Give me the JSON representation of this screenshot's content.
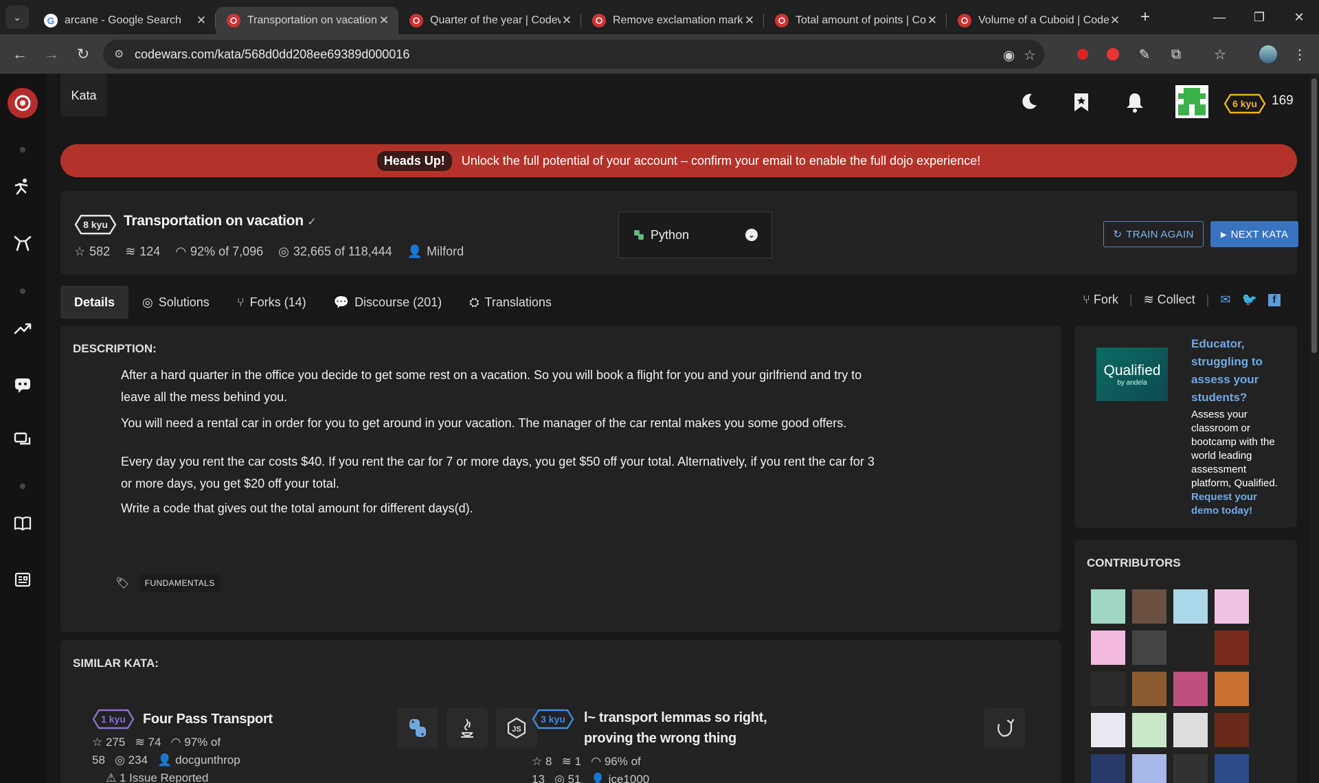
{
  "browser": {
    "tabs": [
      {
        "title": "arcane - Google Search",
        "fav": "google"
      },
      {
        "title": "Transportation on vacation",
        "fav": "codewars",
        "active": true
      },
      {
        "title": "Quarter of the year | Codew",
        "fav": "codewars"
      },
      {
        "title": "Remove exclamation marks",
        "fav": "codewars"
      },
      {
        "title": "Total amount of points | Co",
        "fav": "codewars"
      },
      {
        "title": "Volume of a Cuboid | Code",
        "fav": "codewars"
      }
    ],
    "url": "codewars.com/kata/568d0dd208ee69389d000016"
  },
  "header": {
    "section": "Kata",
    "rank": "6 kyu",
    "honor": "169"
  },
  "banner": {
    "badge": "Heads Up!",
    "text": "Unlock the full potential of your account – confirm your email to enable the full dojo experience!"
  },
  "kata": {
    "rank": "8 kyu",
    "title": "Transportation on vacation",
    "check": "✓",
    "stars": "582",
    "collections": "124",
    "satisfaction": "92% of 7,096",
    "completed": "32,665 of 118,444",
    "author": "Milford",
    "language": "Python",
    "train_again": "TRAIN AGAIN",
    "next_kata": "NEXT KATA"
  },
  "tabs": [
    {
      "label": "Details",
      "icon": "none"
    },
    {
      "label": "Solutions",
      "icon": "target-icon"
    },
    {
      "label": "Forks (14)",
      "icon": "fork-icon"
    },
    {
      "label": "Discourse (201)",
      "icon": "comments-icon"
    },
    {
      "label": "Translations",
      "icon": "sitemap-icon"
    }
  ],
  "tools": {
    "fork": "Fork",
    "collect": "Collect"
  },
  "description": {
    "heading": "DESCRIPTION:",
    "p1": "After a hard quarter in the office you decide to get some rest on a vacation. So you will book a flight for you and your girlfriend and try to leave all the mess behind you.",
    "p2": "You will need a rental car in order for you to get around in your vacation. The manager of the car rental makes you some good offers.",
    "p3": "Every day you rent the car costs $40. If you rent the car for 7 or more days, you get $50 off your total. Alternatively, if you rent the car for 3 or more days, you get $20 off your total.",
    "p4": "Write a code that gives out the total amount for different days(d).",
    "tag": "FUNDAMENTALS"
  },
  "ad": {
    "logo": "Qualified",
    "logo_sub": "by andela",
    "headline": "Educator, struggling to assess your students?",
    "body": "Assess your classroom or bootcamp with the world leading assessment platform, Qualified.",
    "cta": "Request your demo today!"
  },
  "contributors": {
    "heading": "CONTRIBUTORS",
    "colors": [
      "#9fd6c4",
      "#6a5040",
      "#a9d8e8",
      "#f0c0e0",
      "#f2b8dd",
      "#444",
      "#222",
      "#7a2a1a",
      "#2a2a2a",
      "#8a5a30",
      "#c05080",
      "#c87030",
      "#e8e8f0",
      "#c8e8c8",
      "#ddd",
      "#6a2a1a",
      "#2a3a6a",
      "#a8b8e8",
      "#333",
      "#2a4a8a"
    ]
  },
  "similar": {
    "heading": "SIMILAR KATA:",
    "items": [
      {
        "rank": "1 kyu",
        "title": "Four Pass Transport",
        "stars": "275",
        "collections": "74",
        "satisfaction": "97% of",
        "satisfaction_total": "58",
        "completed": "234",
        "author": "docgunthrop",
        "issues": "1 Issue Reported"
      },
      {
        "rank": "3 kyu",
        "title_l1": "l~ transport lemmas so right,",
        "title_l2": "proving the wrong thing",
        "stars": "8",
        "collections": "1",
        "satisfaction": "96% of",
        "satisfaction_total": "13",
        "completed": "51",
        "author": "ice1000"
      }
    ]
  }
}
